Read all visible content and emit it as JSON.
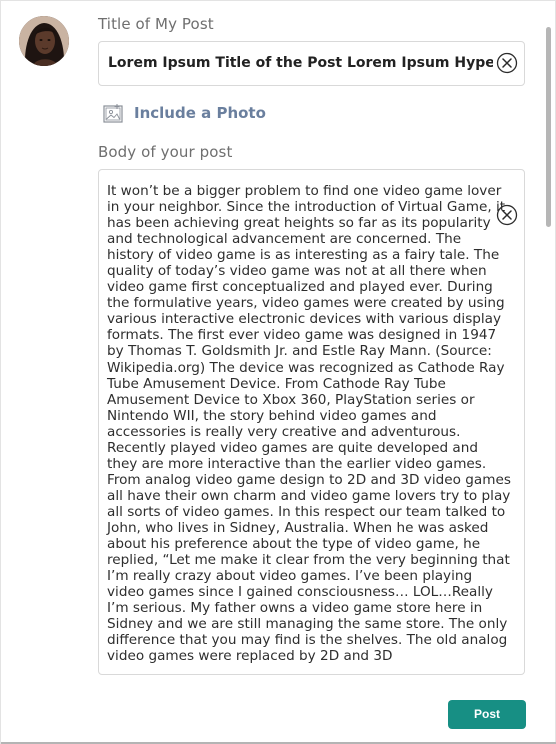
{
  "form": {
    "title_label": "Title of My Post",
    "title_value": "Lorem Ipsum Title of the Post Lorem Ipsum Hypertext",
    "photo_label": "Include a Photo",
    "body_label": "Body of your post",
    "body_value": "It won’t be a bigger problem to find one video game lover in your neighbor. Since the introduction of Virtual Game, it has been achieving great heights so far as its popularity and technological advancement are concerned. The history of video game is as interesting as a fairy tale. The quality of today’s video game was not at all there when video game first conceptualized and played ever. During the formulative years, video games were created by using various interactive electronic devices with various display formats. The first ever video game was designed in 1947 by Thomas T. Goldsmith Jr. and Estle Ray Mann. (Source: Wikipedia.org) The device was recognized as Cathode Ray Tube Amusement Device. From Cathode Ray Tube Amusement Device to Xbox 360, PlayStation series or Nintendo WII, the story behind video games and accessories is really very creative and adventurous. Recently played video games are quite developed and they are more interactive than the earlier video games. From analog video game design to 2D and 3D video games all have their own charm and video game lovers try to play all sorts of video games. In this respect our team talked to John, who lives in Sidney, Australia. When he was asked about his preference about the type of video game, he replied, “Let me make it clear from the very beginning that I’m really crazy about video games. I’ve been playing video games since I gained consciousness… LOL…Really I’m serious. My father owns a video game store here in Sidney and we are still managing the same store. The only difference that you may find is the shelves. The old analog video games were replaced by 2D and 3D",
    "post_label": "Post"
  },
  "icons": {
    "avatar": "user-avatar",
    "clear": "circle-x-icon",
    "photo": "image-icon"
  },
  "colors": {
    "accent": "#178f84",
    "photo_link": "#6a7f9e"
  }
}
